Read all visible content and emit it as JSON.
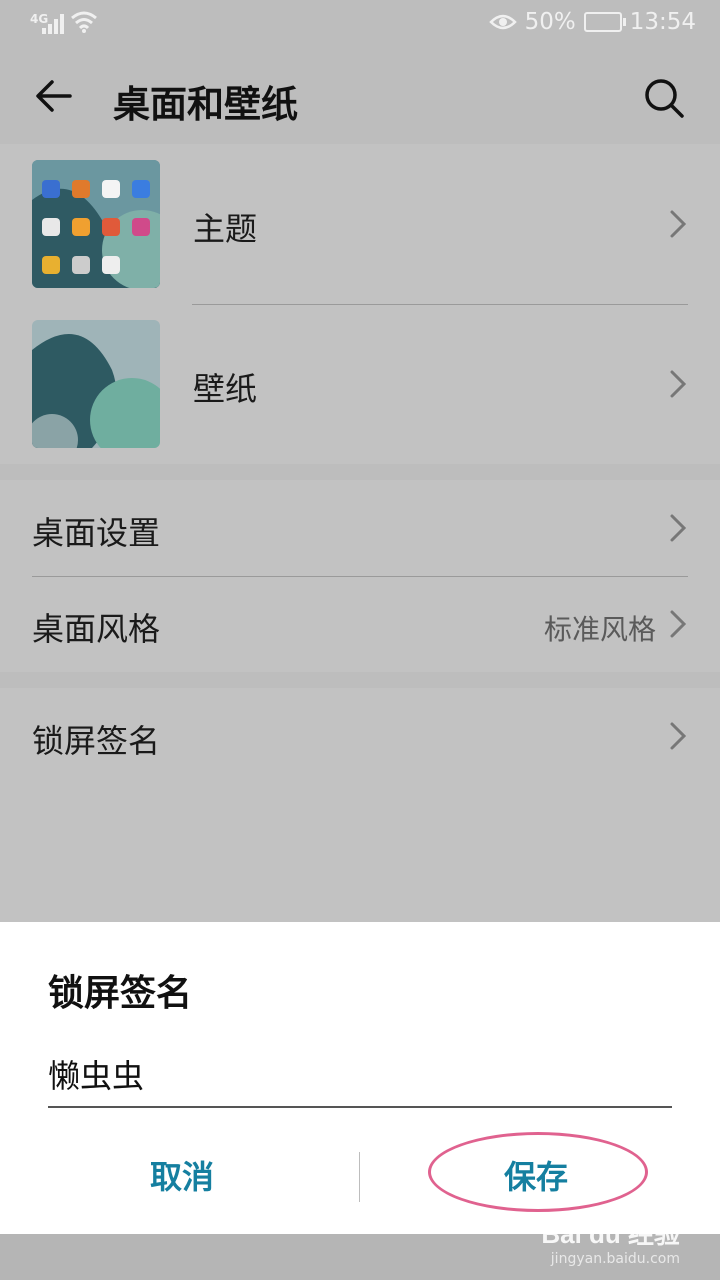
{
  "status_bar": {
    "network": "4G",
    "battery": "50%",
    "time": "13:54",
    "icons": [
      "signal-icon",
      "wifi-icon",
      "eye-comfort-icon",
      "battery-icon"
    ]
  },
  "app_bar": {
    "title": "桌面和壁纸",
    "back_icon": "arrow-left-icon",
    "search_icon": "search-icon"
  },
  "settings": {
    "theme": {
      "label": "主题"
    },
    "wallpaper": {
      "label": "壁纸"
    },
    "home_settings": {
      "label": "桌面设置"
    },
    "home_style": {
      "label": "桌面风格",
      "value": "标准风格"
    },
    "lock_signature": {
      "label": "锁屏签名"
    }
  },
  "dialog": {
    "title": "锁屏签名",
    "input_value": "懒虫虫",
    "cancel_label": "取消",
    "save_label": "保存"
  },
  "watermark": {
    "brand": "Bai du 经验",
    "url": "jingyan.baidu.com"
  },
  "colors": {
    "accent": "#157fa0",
    "highlight_oval": "#e0628f",
    "dim_background": "#bdbdbd"
  }
}
